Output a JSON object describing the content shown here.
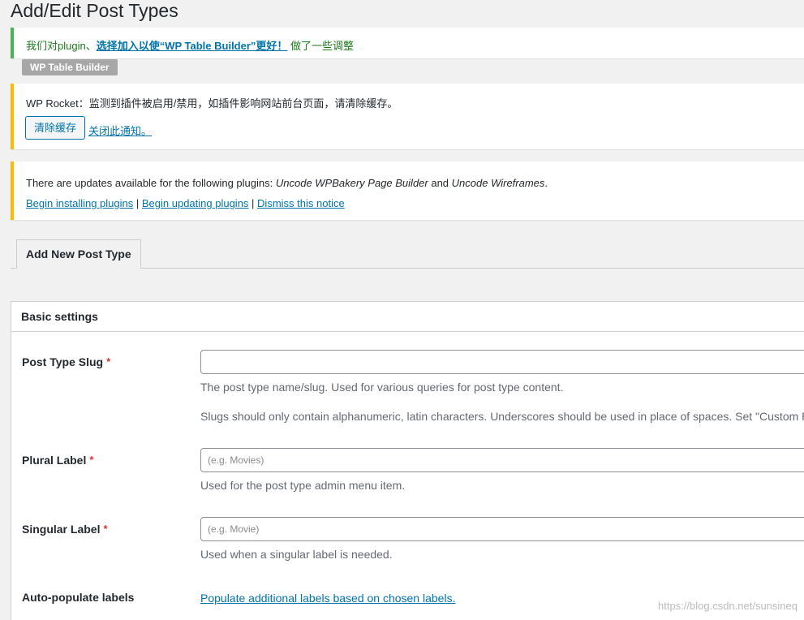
{
  "page": {
    "title": "Add/Edit Post Types"
  },
  "notices": {
    "table_builder": {
      "prefix": "我们对plugin、",
      "link": "选择加入以使“WP Table Builder”更好！",
      "suffix": " 做了一些调整",
      "badge": "WP Table Builder"
    },
    "rocket": {
      "message": "WP Rocket：监测到插件被启用/禁用，如插件影响网站前台页面，请清除缓存。",
      "button_label": "清除缓存",
      "dismiss_label": "关闭此通知。"
    },
    "updates": {
      "prefix": "There are updates available for the following plugins: ",
      "plugin_1": "Uncode WPBakery Page Builder",
      "and": " and ",
      "plugin_2": "Uncode Wireframes",
      "suffix": ".",
      "links": [
        "Begin installing plugins",
        "Begin updating plugins",
        "Dismiss this notice"
      ],
      "separator": " | "
    }
  },
  "tabs": [
    {
      "label": "Add New Post Type",
      "active": true
    }
  ],
  "basic_settings": {
    "header": "Basic settings",
    "slug": {
      "label": "Post Type Slug",
      "required_mark": "*",
      "value": "",
      "placeholder": "",
      "desc_1": "The post type name/slug. Used for various queries for post type content.",
      "desc_2": "Slugs should only contain alphanumeric, latin characters. Underscores should be used in place of spaces. Set \"Custom Rew"
    },
    "plural": {
      "label": "Plural Label",
      "required_mark": "*",
      "value": "",
      "placeholder": "(e.g. Movies)",
      "desc": "Used for the post type admin menu item."
    },
    "singular": {
      "label": "Singular Label",
      "required_mark": "*",
      "value": "",
      "placeholder": "(e.g. Movie)",
      "desc": "Used when a singular label is needed."
    },
    "autopopulate": {
      "label": "Auto-populate labels",
      "link": "Populate additional labels based on chosen labels."
    }
  },
  "watermark": "https://blog.csdn.net/sunsineq",
  "colors": {
    "link": "#0073aa",
    "success": "#46b450",
    "warning": "#ffb900",
    "required": "#dc3232"
  }
}
